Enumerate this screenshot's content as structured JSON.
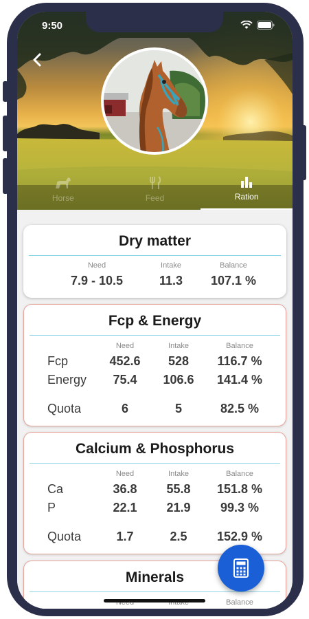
{
  "status": {
    "time": "9:50"
  },
  "tabs": [
    {
      "label": "Horse",
      "icon": "horse-icon"
    },
    {
      "label": "Feed",
      "icon": "cutlery-icon"
    },
    {
      "label": "Ration",
      "icon": "bar-chart-icon"
    }
  ],
  "dry_matter": {
    "title": "Dry matter",
    "headers": [
      "Need",
      "Intake",
      "Balance"
    ],
    "values": [
      "7.9 - 10.5",
      "11.3",
      "107.1 %"
    ]
  },
  "fcp_energy": {
    "title": "Fcp & Energy",
    "headers": [
      "Need",
      "Intake",
      "Balance"
    ],
    "rows": [
      {
        "label": "Fcp",
        "need": "452.6",
        "intake": "528",
        "balance": "116.7 %"
      },
      {
        "label": "Energy",
        "need": "75.4",
        "intake": "106.6",
        "balance": "141.4 %"
      }
    ],
    "quota": {
      "label": "Quota",
      "need": "6",
      "intake": "5",
      "balance": "82.5 %"
    }
  },
  "calcium_phosphorus": {
    "title": "Calcium & Phosphorus",
    "headers": [
      "Need",
      "Intake",
      "Balance"
    ],
    "rows": [
      {
        "label": "Ca",
        "need": "36.8",
        "intake": "55.8",
        "balance": "151.8 %"
      },
      {
        "label": "P",
        "need": "22.1",
        "intake": "21.9",
        "balance": "99.3 %"
      }
    ],
    "quota": {
      "label": "Quota",
      "need": "1.7",
      "intake": "2.5",
      "balance": "152.9 %"
    }
  },
  "minerals": {
    "title": "Minerals",
    "headers": [
      "Need",
      "Intake",
      "Balance"
    ]
  },
  "colors": {
    "accent": "#1b5fd6",
    "alert_border": "#e7a49b",
    "rule": "#8fd3e9"
  },
  "fab": {
    "icon": "calculator-icon"
  }
}
